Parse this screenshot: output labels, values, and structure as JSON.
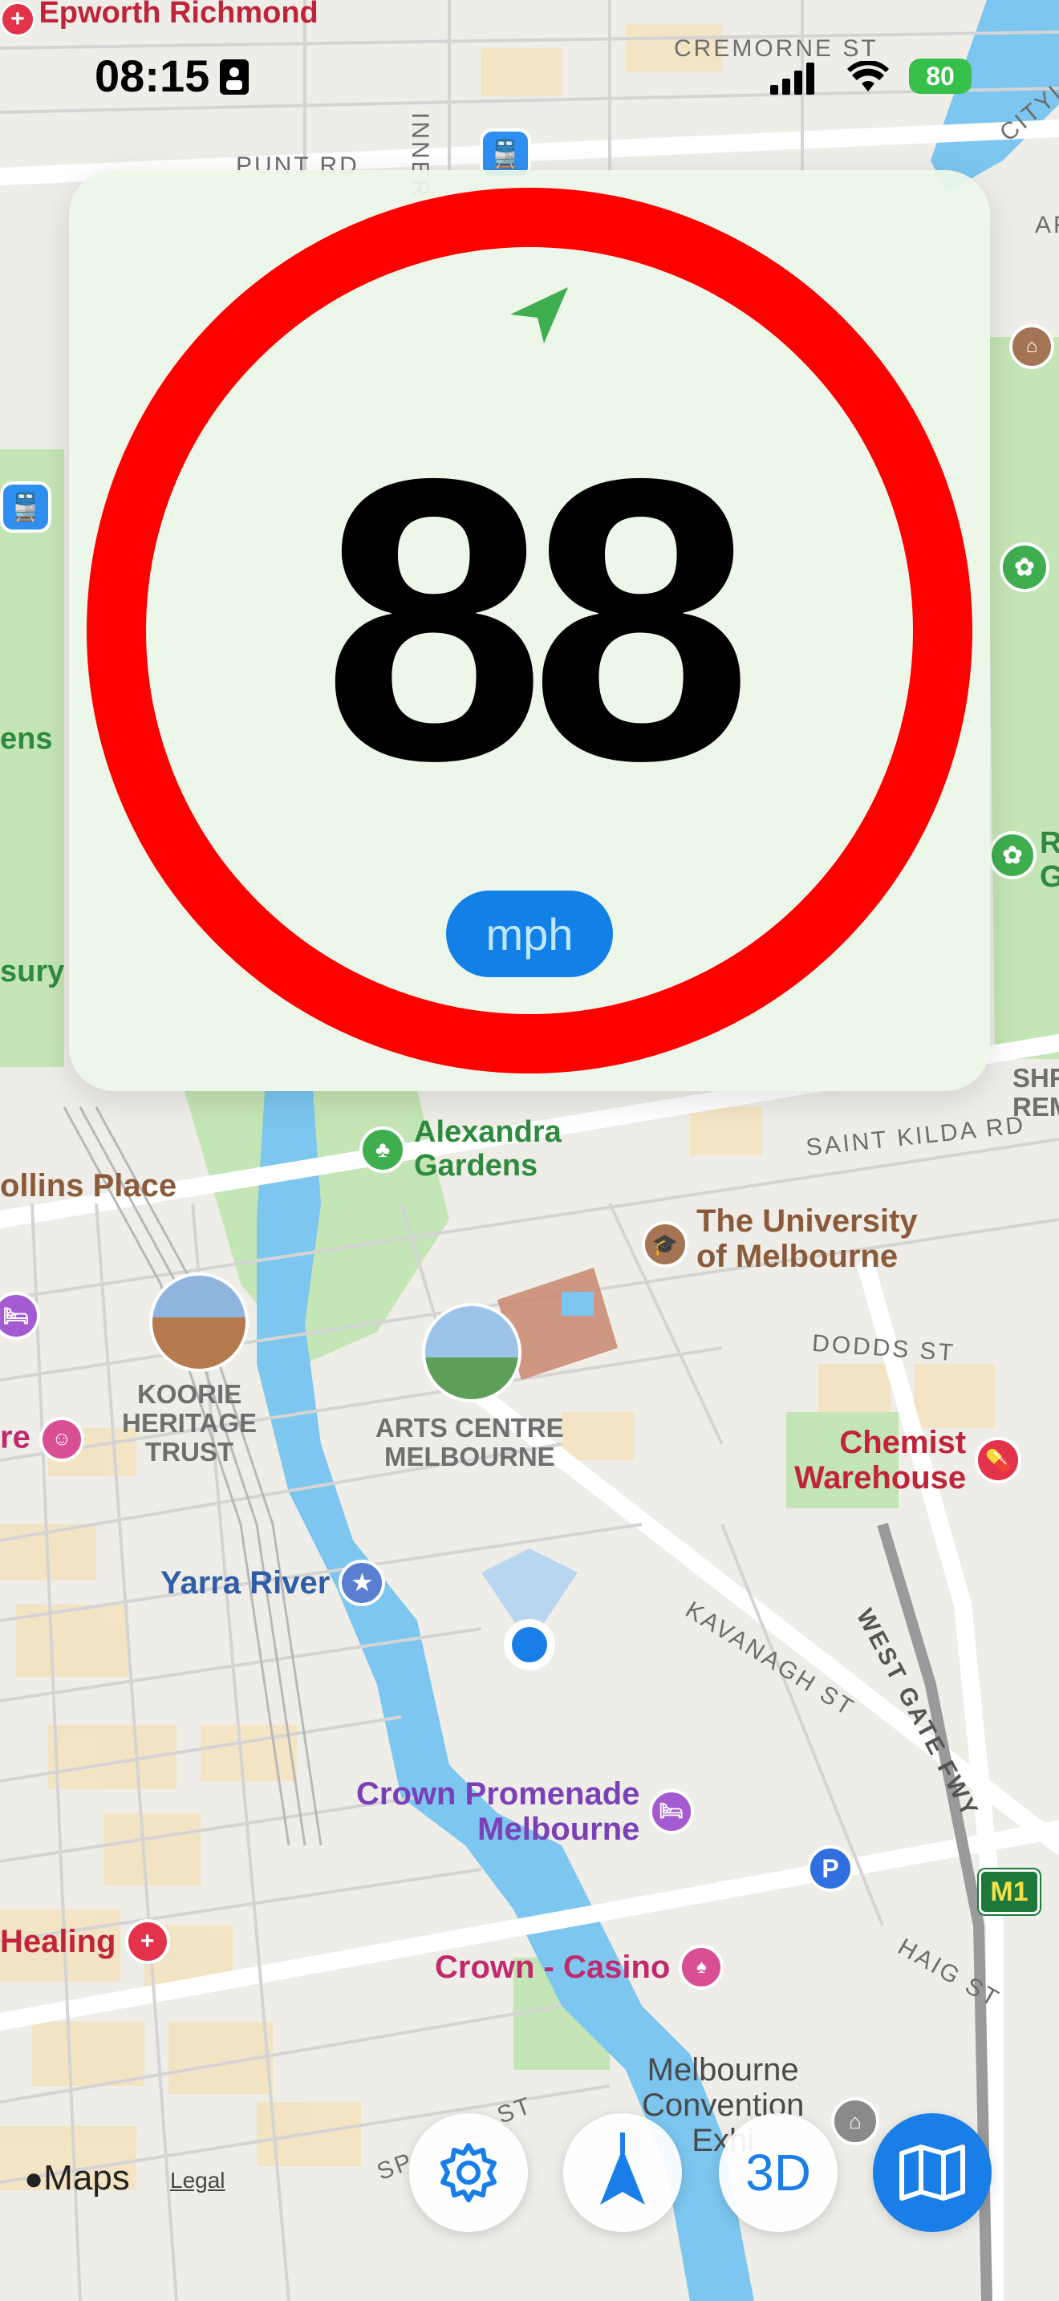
{
  "status_bar": {
    "time": "08:15",
    "battery": "80"
  },
  "speed": {
    "value": "88",
    "unit": "mph"
  },
  "map_labels": {
    "top_place": "Epworth Richmond",
    "cremorne": "CREMORNE ST",
    "punt_rd": "PUNT RD",
    "inner_st": "INNER ST",
    "city_link": "CITYLI",
    "ens": "ens",
    "sury": "sury",
    "alexandra": "Alexandra\nGardens",
    "collins": "ollins Place",
    "saint_kilda": "SAINT KILDA RD",
    "university": "The University\nof Melbourne",
    "dodds": "DODDS ST",
    "koorie": "KOORIE\nHERITAGE\nTRUST",
    "arts_centre": "ARTS CENTRE\nMELBOURNE",
    "chemist": "Chemist\nWarehouse",
    "re": "re",
    "yarra": "Yarra River",
    "kavanagh": "KAVANAGH ST",
    "westgate": "WEST GATE FWY",
    "crown_promenade": "Crown Promenade\nMelbourne",
    "healing": "Healing",
    "crown_casino": "Crown - Casino",
    "m1": "M1",
    "haig": "HAIG ST",
    "convention": "Melbourne\nConvention\nExhi",
    "st": "ST",
    "sp": "SP",
    "ar": "AR",
    "shr": "SHR\nREME",
    "r_g": "R\nG"
  },
  "controls": {
    "three_d": "3D"
  },
  "attribution": {
    "maps": "Maps",
    "legal": "Legal"
  },
  "colors": {
    "speed_ring": "#ff0000",
    "unit_pill": "#1380e8",
    "water": "#7cc6ef",
    "park": "#bfe3b0",
    "location_dot": "#1a7ee8"
  }
}
